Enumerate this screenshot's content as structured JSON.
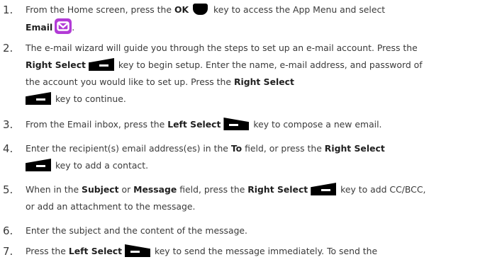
{
  "steps": [
    {
      "number": "1.",
      "l1a": "From the Home screen, press the ",
      "l1_ok": "OK",
      "l1b": " key to access the App Menu and  select",
      "l2_email": "Email",
      "l2_after": "."
    },
    {
      "number": "2.",
      "l1": "The e-mail wizard will guide you through the steps to set up an e-mail account.  Press the",
      "l2_bold": "Right Select",
      "l2_rest": " key to begin setup. Enter the name, e-mail address,  and password of",
      "l3_a": "the account you would like to set up. Press the ",
      "l3_bold": "Right Select",
      "l4": " key to continue."
    },
    {
      "number": "3.",
      "a": "From the Email inbox, press the ",
      "bold": "Left Select",
      "b": " key to compose a new email."
    },
    {
      "number": "4.",
      "a": "Enter the recipient(s) email address(es) in the ",
      "to": "To",
      "b": " field, or press the ",
      "bold": "Right Select",
      "l2": " key to add a contact."
    },
    {
      "number": "5.",
      "a": "When in the ",
      "subject": "Subject",
      "or": " or ",
      "message": "Message",
      "b": " field, press the ",
      "bold": "Right Select",
      "c": " key to add  CC/BCC,",
      "l2": "or add an attachment to the message."
    },
    {
      "number": "6.",
      "text": "Enter the subject and the content of the message."
    },
    {
      "number": "7.",
      "a": "Press the ",
      "bold": "Left Select",
      "b": " key to send the message immediately. To send the"
    }
  ],
  "icons": {
    "ok_key": "ok-key-icon",
    "email_app": "email-app-icon",
    "right_select": "right-select-key-icon",
    "left_select": "left-select-key-icon"
  },
  "colors": {
    "text": "#3a3a3a",
    "email_icon": "#b23bd6"
  }
}
